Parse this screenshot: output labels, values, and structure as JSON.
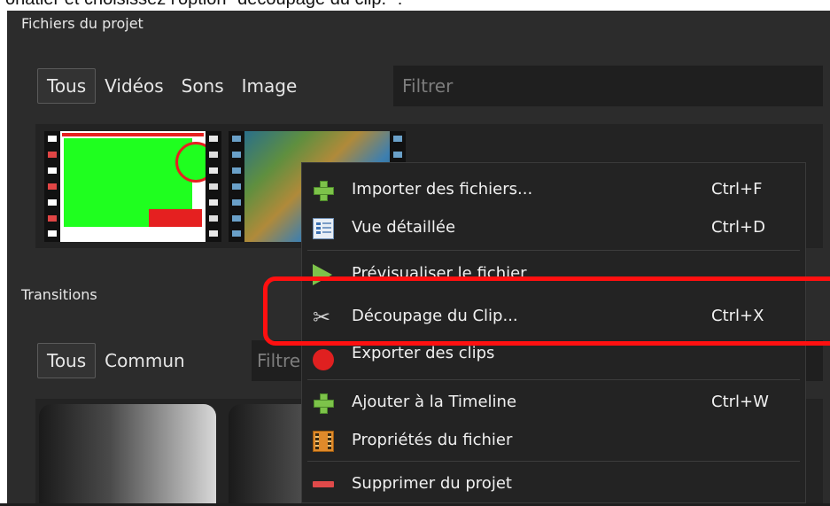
{
  "caption": "onatier et choisissez l'option \"découpage du clip.\" :",
  "project_files": {
    "title": "Fichiers du projet",
    "tabs": [
      "Tous",
      "Vidéos",
      "Sons",
      "Image"
    ],
    "filter_placeholder": "Filtrer"
  },
  "transitions": {
    "title": "Transitions",
    "tabs": [
      "Tous",
      "Commun"
    ],
    "filter_placeholder": "Filtrer"
  },
  "context_menu": {
    "items": [
      {
        "label": "Importer des fichiers...",
        "shortcut": "Ctrl+F",
        "icon": "plus-icon"
      },
      {
        "label": "Vue détaillée",
        "shortcut": "Ctrl+D",
        "icon": "details-view-icon"
      },
      {
        "label": "Prévisualiser le fichier",
        "shortcut": "",
        "icon": "play-icon"
      },
      {
        "label": "Découpage du Clip...",
        "shortcut": "Ctrl+X",
        "icon": "scissors-icon"
      },
      {
        "label": "Exporter des clips",
        "shortcut": "",
        "icon": "record-icon"
      },
      {
        "label": "Ajouter à la Timeline",
        "shortcut": "Ctrl+W",
        "icon": "plus-icon"
      },
      {
        "label": "Propriétés du fichier",
        "shortcut": "",
        "icon": "film-icon"
      },
      {
        "label": "Supprimer du projet",
        "shortcut": "",
        "icon": "minus-icon"
      }
    ]
  },
  "colors": {
    "highlight": "#ff1010",
    "background": "#2c2c2c",
    "menu_background": "#232323",
    "accent_green": "#7dc34a"
  }
}
